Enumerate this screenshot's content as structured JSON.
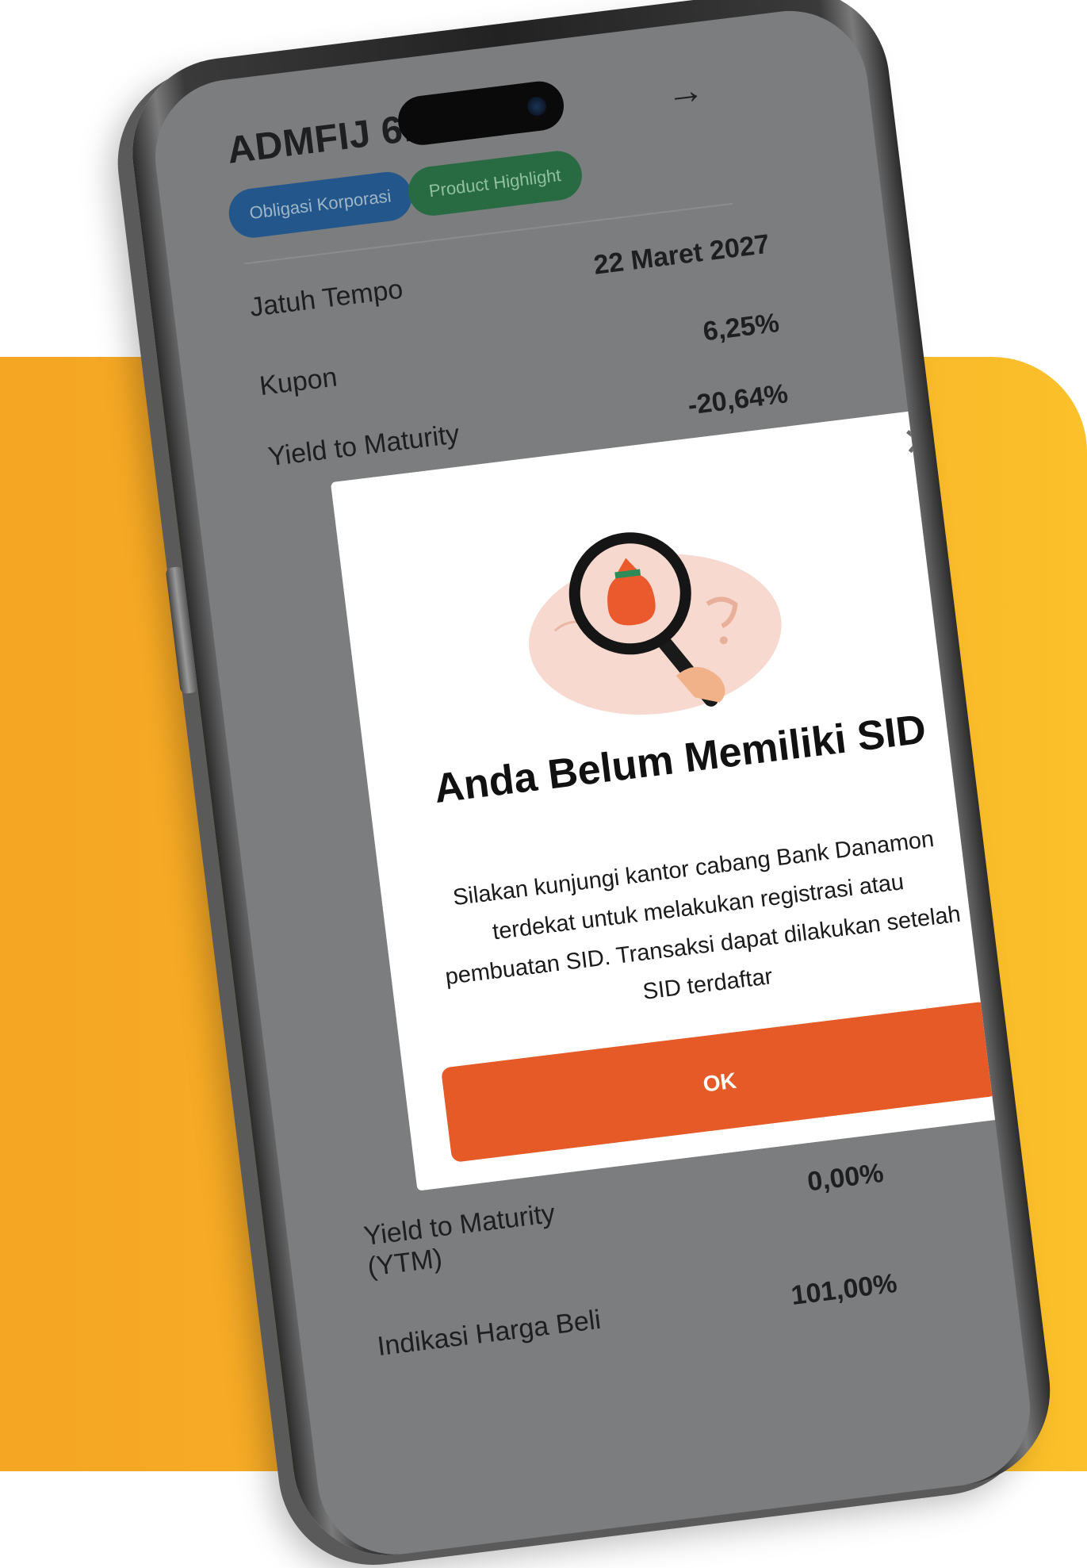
{
  "colors": {
    "accent_orange": "#f5a623",
    "ok_button": "#e55a26",
    "chip_blue": "#23568a",
    "chip_green": "#286b42"
  },
  "header": {
    "title": "ADMFIJ 6.2",
    "forward_icon": "arrow-right-icon"
  },
  "chips": [
    {
      "label": "Obligasi Korporasi"
    },
    {
      "label": "Product Highlight"
    }
  ],
  "details": [
    {
      "label": "Jatuh Tempo",
      "value": "22 Maret 2027"
    },
    {
      "label": "Kupon",
      "value": "6,25%"
    },
    {
      "label": "Yield to Maturity",
      "value": "-20,64%"
    }
  ],
  "details_bottom": [
    {
      "label": "Yield to Maturity (YTM)",
      "value": "0,00%"
    },
    {
      "label": "Indikasi Harga Beli",
      "value": "101,00%"
    }
  ],
  "modal": {
    "close_icon": "close-icon",
    "illustration": "magnifier-money-bag-illustration",
    "title": "Anda Belum Memiliki SID",
    "body": "Silakan kunjungi kantor cabang Bank Danamon terdekat untuk melakukan registrasi atau pembuatan SID. Transaksi dapat dilakukan setelah SID terdaftar",
    "ok_label": "OK"
  }
}
